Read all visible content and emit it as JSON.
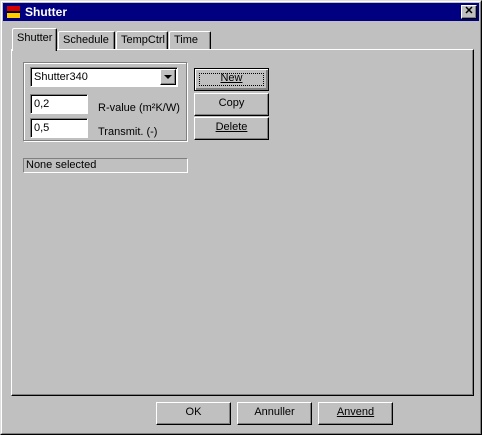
{
  "window": {
    "title": "Shutter",
    "close_glyph": "✕"
  },
  "tabs": [
    {
      "label": "Shutter",
      "active": true
    },
    {
      "label": "Schedule",
      "active": false
    },
    {
      "label": "TempCtrl",
      "active": false
    },
    {
      "label": "Time",
      "active": false
    }
  ],
  "shutter_panel": {
    "combo_value": "Shutter340",
    "r_value": "0,2",
    "r_value_label": "R-value (m²K/W)",
    "transmit": "0,5",
    "transmit_label": "Transmit. (-)",
    "status": "None selected",
    "new_button": "New",
    "copy_button": "Copy",
    "delete_button": "Delete"
  },
  "footer": {
    "ok_button": "OK",
    "cancel_button": "Annuller",
    "apply_button": "Anvend"
  },
  "colors": {
    "titlebar": "#000080",
    "face": "#c0c0c0",
    "icon_red": "#d40000",
    "icon_yellow": "#ffcc00"
  }
}
